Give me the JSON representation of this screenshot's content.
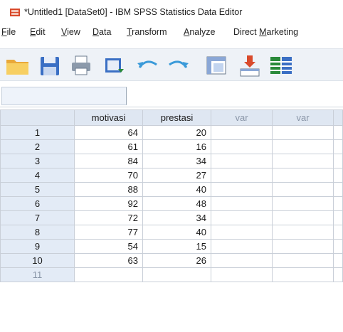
{
  "window": {
    "title": "*Untitled1 [DataSet0] - IBM SPSS Statistics Data Editor"
  },
  "menu": [
    {
      "label": "File",
      "underline": "F"
    },
    {
      "label": "Edit",
      "underline": "E"
    },
    {
      "label": "View",
      "underline": "V"
    },
    {
      "label": "Data",
      "underline": "D"
    },
    {
      "label": "Transform",
      "underline": "T"
    },
    {
      "label": "Analyze",
      "underline": "A"
    },
    {
      "label": "Direct Marketing",
      "underline": "M"
    }
  ],
  "toolbar": {
    "icons": [
      "open-folder-icon",
      "save-icon",
      "print-icon",
      "dialog-recall-icon",
      "undo-icon",
      "redo-icon",
      "goto-case-icon",
      "goto-variable-icon",
      "variables-icon"
    ]
  },
  "grid": {
    "columns": [
      "motivasi",
      "prestasi",
      "var",
      "var"
    ],
    "rows": [
      {
        "n": "1",
        "motivasi": "64",
        "prestasi": "20"
      },
      {
        "n": "2",
        "motivasi": "61",
        "prestasi": "16"
      },
      {
        "n": "3",
        "motivasi": "84",
        "prestasi": "34"
      },
      {
        "n": "4",
        "motivasi": "70",
        "prestasi": "27"
      },
      {
        "n": "5",
        "motivasi": "88",
        "prestasi": "40"
      },
      {
        "n": "6",
        "motivasi": "92",
        "prestasi": "48"
      },
      {
        "n": "7",
        "motivasi": "72",
        "prestasi": "34"
      },
      {
        "n": "8",
        "motivasi": "77",
        "prestasi": "40"
      },
      {
        "n": "9",
        "motivasi": "54",
        "prestasi": "15"
      },
      {
        "n": "10",
        "motivasi": "63",
        "prestasi": "26"
      },
      {
        "n": "11",
        "motivasi": "",
        "prestasi": ""
      }
    ]
  }
}
